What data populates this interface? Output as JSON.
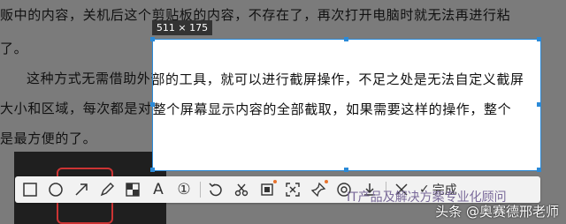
{
  "document": {
    "line1": "贩中的内容，关机后这个剪贴板的内容，不存在了，再次打开电脑时就无法再进行粘",
    "line2": "了。",
    "line3": "这种方式无需借助外部的工具，就可以进行截屏操作，不足之处是无法自定义截屏",
    "line4": "大小和区域，每次都是对整个屏幕显示内容的全部截取，如果需要这样的操作，整个",
    "line5": "是最方便的了。"
  },
  "selection": {
    "size_label": "511 × 175"
  },
  "toolbar": {
    "tools": [
      {
        "icon": "rectangle-icon"
      },
      {
        "icon": "ellipse-icon"
      },
      {
        "icon": "arrow-icon"
      },
      {
        "icon": "pen-icon"
      },
      {
        "icon": "mosaic-icon"
      },
      {
        "icon": "text-icon",
        "glyph": "A"
      },
      {
        "icon": "number-icon",
        "glyph": "①"
      },
      {
        "icon": "undo-icon"
      },
      {
        "icon": "cutout-icon"
      },
      {
        "icon": "pin-image-icon"
      },
      {
        "icon": "ocr-icon"
      },
      {
        "icon": "pin-icon"
      },
      {
        "icon": "translate-icon"
      },
      {
        "icon": "download-icon"
      },
      {
        "icon": "close-icon"
      }
    ],
    "finish_label": "完成"
  },
  "watermark": {
    "channel": "IT产品及解决方案专业化顾问",
    "author": "头条 @奥赛德邢老师"
  },
  "colors": {
    "accent": "#2b8ad8",
    "dot": "#e8732d"
  }
}
